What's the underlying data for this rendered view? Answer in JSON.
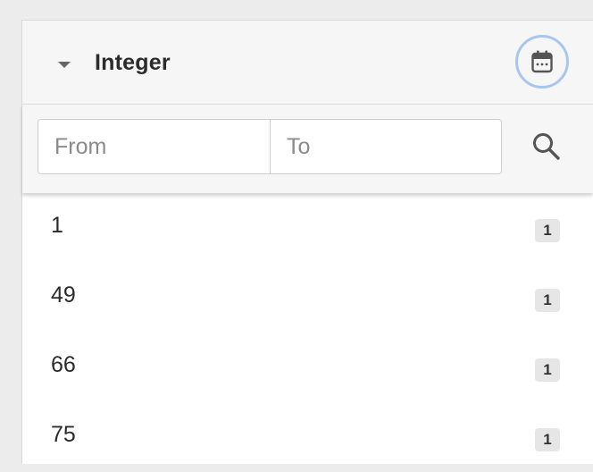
{
  "facet": {
    "title": "Integer",
    "icons": {
      "collapse": "caret-down-icon",
      "calendar": "calendar-icon",
      "search": "search-icon"
    },
    "calendar_ring_color": "#a9c6ef"
  },
  "range": {
    "from_placeholder": "From",
    "to_placeholder": "To",
    "from_value": "",
    "to_value": ""
  },
  "values": [
    {
      "label": "1",
      "count": "1"
    },
    {
      "label": "49",
      "count": "1"
    },
    {
      "label": "66",
      "count": "1"
    },
    {
      "label": "75",
      "count": "1"
    }
  ]
}
